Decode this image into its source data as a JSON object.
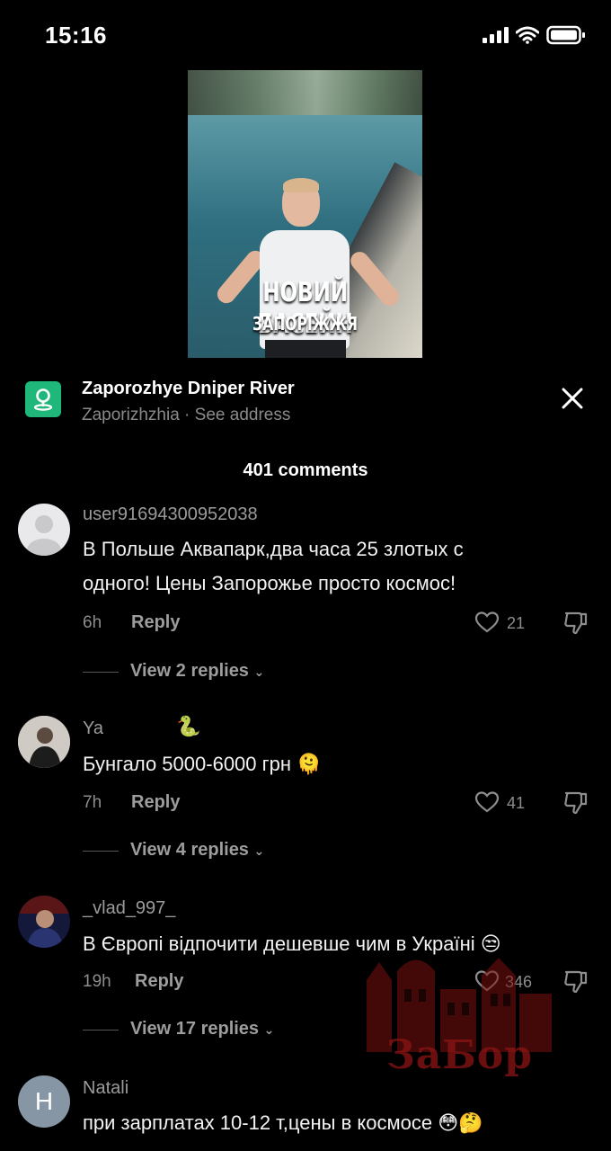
{
  "status_bar": {
    "time": "15:16"
  },
  "video": {
    "caption_main": "НОВИЙ БАСЕЙН",
    "caption_sub": "ЗАПОРІЖЖЯ"
  },
  "location": {
    "title": "Zaporozhye Dniper River",
    "subtitle": "Zaporizhzhia · See address"
  },
  "comments_count": "401 comments",
  "comments": [
    {
      "username": "user91694300952038",
      "emoji_after_name": "",
      "text_line1": "В Польше Аквапарк,два часа 25 злотых с",
      "text_line2": "одного! Цены Запорожье просто космос!",
      "time": "6h",
      "reply": "Reply",
      "likes": "21",
      "view_replies": "View 2 replies"
    },
    {
      "username": "Ya",
      "emoji_after_name": "🐍",
      "text_line1": "Бунгало 5000-6000 грн 🫠",
      "time": "7h",
      "reply": "Reply",
      "likes": "41",
      "view_replies": "View 4 replies"
    },
    {
      "username": "_vlad_997_",
      "text_line1": "В Європі відпочити дешевше чим в Україні 😒",
      "time": "19h",
      "reply": "Reply",
      "likes": "346",
      "view_replies": "View 17 replies"
    },
    {
      "username": "Natali",
      "avatar_letter": "H",
      "text_line1": "при зарплатах 10-12 т,цены в космосе 😳🤔"
    }
  ],
  "watermark": {
    "text": "ЗаБор"
  },
  "colors": {
    "background": "#000000",
    "muted": "#8d8d8d",
    "location_green": "#1fb77a",
    "watermark": "#8d1414"
  }
}
